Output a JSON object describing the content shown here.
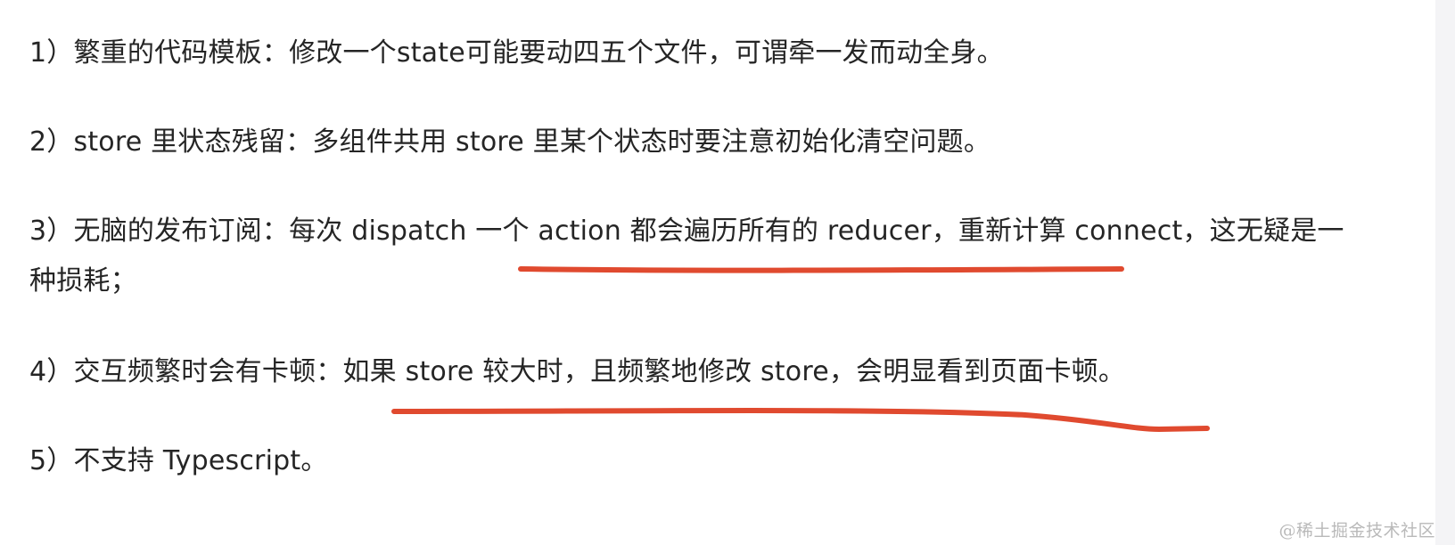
{
  "document": {
    "items": [
      {
        "text": "1）繁重的代码模板：修改一个state可能要动四五个文件，可谓牵一发而动全身。"
      },
      {
        "text": "2）store 里状态残留：多组件共用 store 里某个状态时要注意初始化清空问题。"
      },
      {
        "text": "3）无脑的发布订阅：每次 dispatch 一个 action 都会遍历所有的 reducer，重新计算 connect，这无疑是一",
        "continuation": "种损耗；"
      },
      {
        "text": "4）交互频繁时会有卡顿：如果 store 较大时，且频繁地修改 store，会明显看到页面卡顿。"
      },
      {
        "text": "5）不支持 Typescript。"
      }
    ]
  },
  "watermark": "@稀土掘金技术社区",
  "colors": {
    "text": "#252525",
    "underline": "#e04a2f",
    "watermark": "#b9b9b9"
  }
}
